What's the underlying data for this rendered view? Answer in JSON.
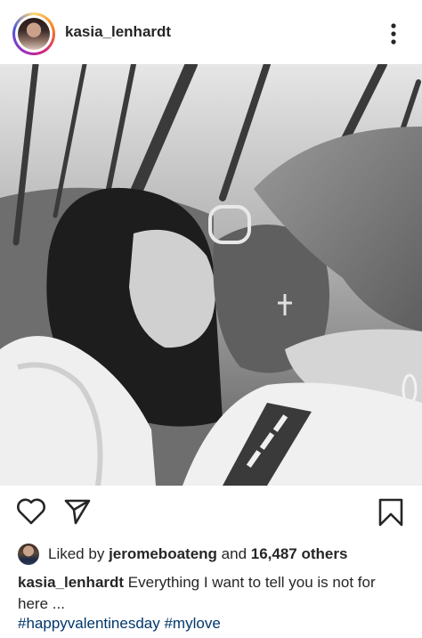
{
  "post": {
    "username": "kasia_lenhardt",
    "menu_icon": "more-vertical-icon"
  },
  "actions": {
    "like_icon": "heart-icon",
    "share_icon": "paper-plane-icon",
    "save_icon": "bookmark-icon"
  },
  "likes": {
    "prefix": "Liked by",
    "user": "jeromeboateng",
    "conjunction": "and",
    "count": "16,487 others"
  },
  "caption": {
    "username": "kasia_lenhardt",
    "text": "Everything I want to tell you is not for here ..."
  },
  "hashtags": [
    "#happyvalentinesday",
    "#mylove"
  ],
  "colors": {
    "text": "#262626",
    "hashtag": "#00376b",
    "story_ring_start": "#feda75",
    "story_ring_end": "#962fbf"
  }
}
